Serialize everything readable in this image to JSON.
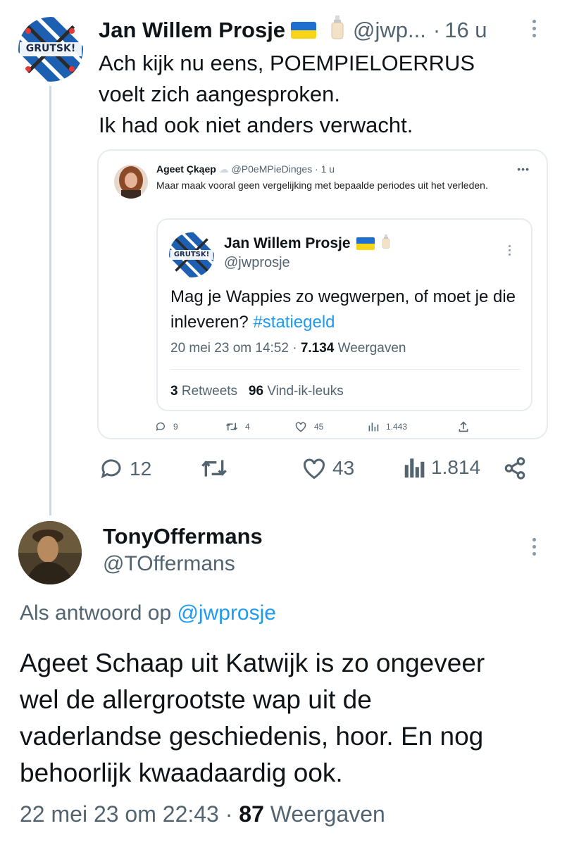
{
  "tweet1": {
    "name": "Jan Willem Prosje",
    "handle": "@jwp...",
    "separator": "·",
    "time": "16 u",
    "avatar_text": "GRUTSK!",
    "lines": [
      "Ach kijk nu eens, POEMPIELOERRUS",
      "voelt zich aangesproken.",
      "Ik had ook niet anders verwacht."
    ],
    "quote": {
      "name": "Ageet Çkąep",
      "meta": "@P0eMPieDinges · 1 u",
      "more": "•••",
      "text": "Maar maak vooral geen vergelijking met bepaalde periodes uit het verleden.",
      "inner": {
        "name": "Jan Willem Prosje",
        "handle": "@jwprosje",
        "avatar_text": "GRUTSK!",
        "text": "Mag je Wappies zo wegwerpen, of moet je die inleveren?",
        "hashtag": "#statiegeld",
        "date": "20 mei 23 om 14:52 · ",
        "views": "7.134",
        "views_label": " Weergaven",
        "retweets": "3",
        "retweets_label": " Retweets",
        "likes": "96",
        "likes_label": " Vind-ik-leuks"
      },
      "actions": {
        "replies": "9",
        "retweets": "4",
        "likes": "45",
        "views": "1.443"
      }
    },
    "actions": {
      "replies": "12",
      "likes": "43",
      "views": "1.814"
    }
  },
  "tweet2": {
    "name": "TonyOffermans",
    "handle": "@TOffermans",
    "reply_prefix": "Als antwoord op ",
    "reply_mention": "@jwprosje",
    "lines": [
      "Ageet Schaap uit Katwijk is zo ongeveer",
      "wel de allergrootste wap uit de",
      "vaderlandse geschiedenis, hoor. En nog",
      "behoorlijk kwaadaardig ook."
    ],
    "date": "22 mei 23 om 22:43 · ",
    "views": "87",
    "views_label": " Weergaven"
  },
  "colors": {
    "link": "#1d9bf0",
    "secondary": "#536471",
    "text": "#0f1419"
  }
}
